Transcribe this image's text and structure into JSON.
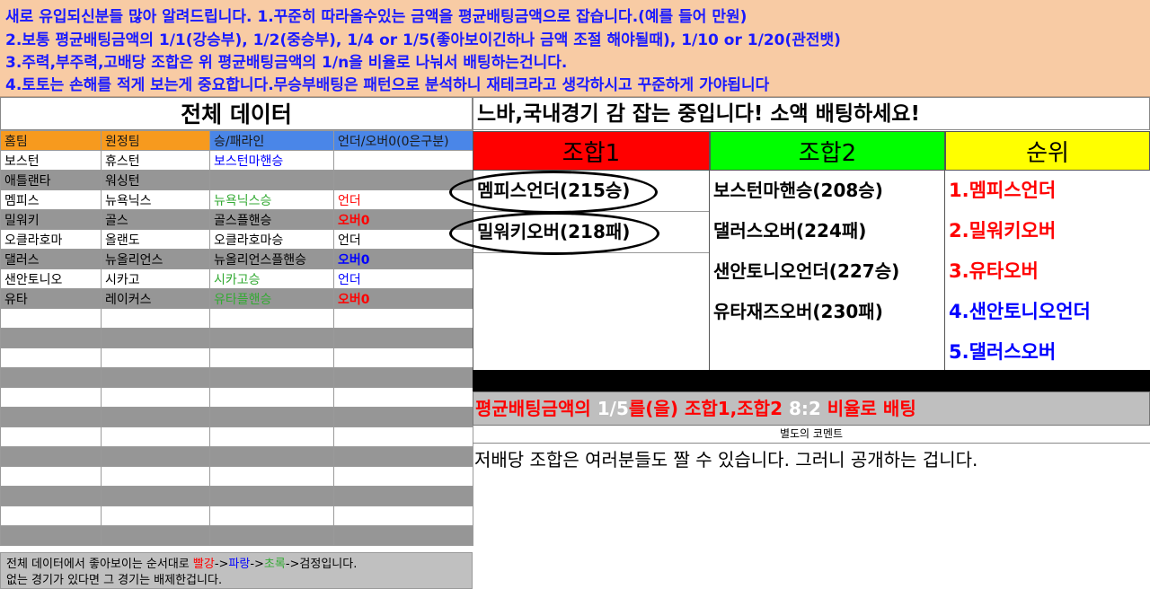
{
  "banner": {
    "line1": "새로 유입되신분들 많아 알려드립니다. 1.꾸준히 따라올수있는 금액을 평균배팅금액으로 잡습니다.(예를 들어 만원)",
    "line2": " 2.보통 평균배팅금액의 1/1(강승부), 1/2(중승부), 1/4 or 1/5(좋아보이긴하나 금액 조절 해야될때), 1/10 or 1/20(관전뱃)",
    "line3": " 3.주력,부주력,고배당 조합은 위 평균배팅금액의 1/n을 비율로 나눠서 배팅하는건니다.",
    "line4": "4.토토는 손해를 적게 보는게 중요합니다.무승부배팅은 패턴으로 분석하니 재테크라고 생각하시고 꾸준하게 가야됩니다"
  },
  "left": {
    "title": "전체 데이터",
    "headers": [
      "홈팀",
      "원정팀",
      "승/패라인",
      "언더/오버0(0은구분)"
    ],
    "rows": [
      {
        "home": "보스턴",
        "away": "휴스턴",
        "line": "보스턴마핸승",
        "ou": ""
      },
      {
        "home": "애틀랜타",
        "away": "워싱턴",
        "line": "",
        "ou": ""
      },
      {
        "home": "멤피스",
        "away": "뉴욕닉스",
        "line": "뉴욕닉스승",
        "ou": "언더"
      },
      {
        "home": "밀워키",
        "away": "골스",
        "line": "골스플핸승",
        "ou": "오버0"
      },
      {
        "home": "오클라호마",
        "away": "올랜도",
        "line": "오클라호마승",
        "ou": "언더"
      },
      {
        "home": "댈러스",
        "away": "뉴올리언스",
        "line": "뉴올리언스플핸승",
        "ou": "오버0"
      },
      {
        "home": "샌안토니오",
        "away": "시카고",
        "line": "시카고승",
        "ou": "언더"
      },
      {
        "home": "유타",
        "away": "레이커스",
        "line": "유타플핸승",
        "ou": "오버0"
      }
    ],
    "footer": {
      "part1": "전체 데이터에서 좋아보이는 순서대로 ",
      "red": "빨강",
      "arrow1": "->",
      "blue": "파랑",
      "arrow2": "->",
      "green": "초록",
      "part2": "->검정입니다.",
      "line2": "없는 경기가 있다면 그 경기는 배제한겁니다."
    }
  },
  "right": {
    "title": "느바,국내경기 감 잡는 중입니다! 소액 배팅하세요!",
    "combo1": {
      "header": "조합1",
      "items": [
        "멤피스언더(215승)",
        "밀워키오버(218패)"
      ]
    },
    "combo2": {
      "header": "조합2",
      "items": [
        "보스턴마핸승(208승)",
        "댈러스오버(224패)",
        "샌안토니오언더(227승)",
        "유타재즈오버(230패)"
      ]
    },
    "rank": {
      "header": "순위",
      "items": [
        "1.멤피스언더",
        "2.밀워키오버",
        "3.유타오버",
        "4.샌안토니오언더",
        "5.댈러스오버"
      ]
    },
    "betting": {
      "part1": "평균배팅금액의 ",
      "ratio1": "1/5",
      "part2": "를(을) 조합1,조합2 ",
      "ratio2": "8:2",
      "part3": " 비율로 배팅"
    },
    "comment_label": "별도의 코멘트",
    "comment_text": "저배당 조합은 여러분들도 짤 수 있습니다. 그러니 공개하는 겁니다."
  },
  "colors": {
    "banner_bg": "#f8cba4",
    "banner_text": "#1a1aff",
    "header_orange": "#f79a1e",
    "header_blue": "#4a86e8",
    "combo1_bg": "#ff0000",
    "combo2_bg": "#00ff00",
    "rank_bg": "#ffff00",
    "row_gray": "#969696"
  }
}
